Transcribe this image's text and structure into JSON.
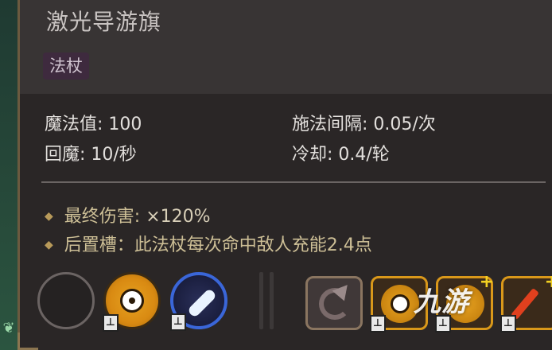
{
  "title": "激光导游旗",
  "tag": "法杖",
  "stats": {
    "mana_label": "魔法值: 100",
    "cast_delay_label": "施法间隔: 0.05/次",
    "recharge_label": "回魔: 10/秒",
    "cooldown_label": "冷却: 0.4/轮"
  },
  "bullets": {
    "damage_label": "最终伤害:",
    "damage_value": "×120%",
    "slot_label": "后置槽：此法杖每次命中敌人充能2.4点"
  },
  "slots": [
    {
      "icon": "empty-slot-icon",
      "locked": false
    },
    {
      "icon": "target-orb-icon",
      "locked": true,
      "lock_glyph": "⊥"
    },
    {
      "icon": "feather-icon",
      "locked": true,
      "lock_glyph": "⊥"
    },
    {
      "icon": "spiral-arrow-icon",
      "locked": false
    },
    {
      "icon": "target-orb-icon",
      "locked": true,
      "lock_glyph": "⊥"
    },
    {
      "icon": "fire-orb-icon",
      "locked": true,
      "lock_glyph": "⊥"
    },
    {
      "icon": "red-arrow-icon",
      "locked": true,
      "lock_glyph": "⊥"
    }
  ],
  "watermark": "九游",
  "colors": {
    "panel_bg": "#2a2626",
    "header_bg": "#383434",
    "title_text": "#c9c4c2",
    "bullet_text": "#cdbf96",
    "accent_orange": "#e6a221",
    "accent_blue": "#3a66d8"
  }
}
